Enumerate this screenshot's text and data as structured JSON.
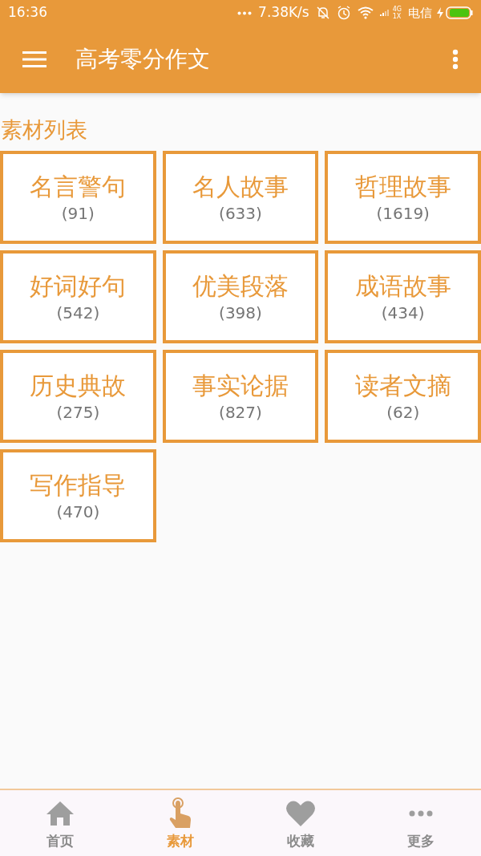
{
  "status_bar": {
    "time": "16:36",
    "speed": "7.38K/s",
    "network_1": "4G",
    "network_2": "1X",
    "carrier": "电信"
  },
  "app_bar": {
    "title": "高考零分作文"
  },
  "section_title": "素材列表",
  "categories": [
    {
      "name": "名言警句",
      "count": "(91)"
    },
    {
      "name": "名人故事",
      "count": "(633)"
    },
    {
      "name": "哲理故事",
      "count": "(1619)"
    },
    {
      "name": "好词好句",
      "count": "(542)"
    },
    {
      "name": "优美段落",
      "count": "(398)"
    },
    {
      "name": "成语故事",
      "count": "(434)"
    },
    {
      "name": "历史典故",
      "count": "(275)"
    },
    {
      "name": "事实论据",
      "count": "(827)"
    },
    {
      "name": "读者文摘",
      "count": "(62)"
    },
    {
      "name": "写作指导",
      "count": "(470)"
    }
  ],
  "bottom_nav": [
    {
      "label": "首页",
      "kind": "home",
      "selected": false
    },
    {
      "label": "素材",
      "kind": "hand",
      "selected": true
    },
    {
      "label": "收藏",
      "kind": "heart",
      "selected": false
    },
    {
      "label": "更多",
      "kind": "more",
      "selected": false
    }
  ]
}
